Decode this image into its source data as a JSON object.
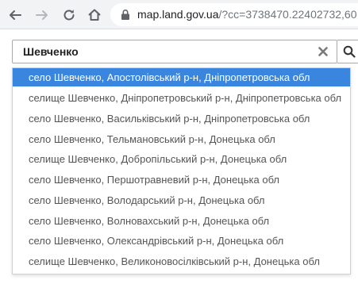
{
  "browser": {
    "url_host": "map.land.gov.ua",
    "url_rest": "/?cc=3738470.22402732,60",
    "icons": {
      "back": "arrow-left-icon",
      "forward": "arrow-right-icon",
      "reload": "reload-icon",
      "home": "home-icon",
      "lock": "lock-icon"
    }
  },
  "search": {
    "value": "Шевченко",
    "icons": {
      "clear": "close-icon",
      "submit": "search-icon"
    }
  },
  "suggestions": [
    {
      "label": "село Шевченко, Апостолівський р-н, Дніпропетровська обл",
      "selected": true
    },
    {
      "label": "селище Шевченко, Дніпропетровський р-н, Дніпропетровська обл",
      "selected": false
    },
    {
      "label": "село Шевченко, Васильківський р-н, Дніпропетровська обл",
      "selected": false
    },
    {
      "label": "село Шевченко, Тельмановський р-н, Донецька обл",
      "selected": false
    },
    {
      "label": "селище Шевченко, Добропільський р-н, Донецька обл",
      "selected": false
    },
    {
      "label": "село Шевченко, Першотравневий р-н, Донецька обл",
      "selected": false
    },
    {
      "label": "село Шевченко, Володарський р-н, Донецька обл",
      "selected": false
    },
    {
      "label": "село Шевченко, Волновахський р-н, Донецька обл",
      "selected": false
    },
    {
      "label": "село Шевченко, Олександрівський р-н, Донецька обл",
      "selected": false
    },
    {
      "label": "селище Шевченко, Великоновосілківський р-н, Донецька обл",
      "selected": false
    }
  ],
  "colors": {
    "selected_bg": "#3a86df",
    "selected_text": "#ffffff",
    "item_text": "#555555",
    "toolbar_bg": "#f1f3f4"
  }
}
